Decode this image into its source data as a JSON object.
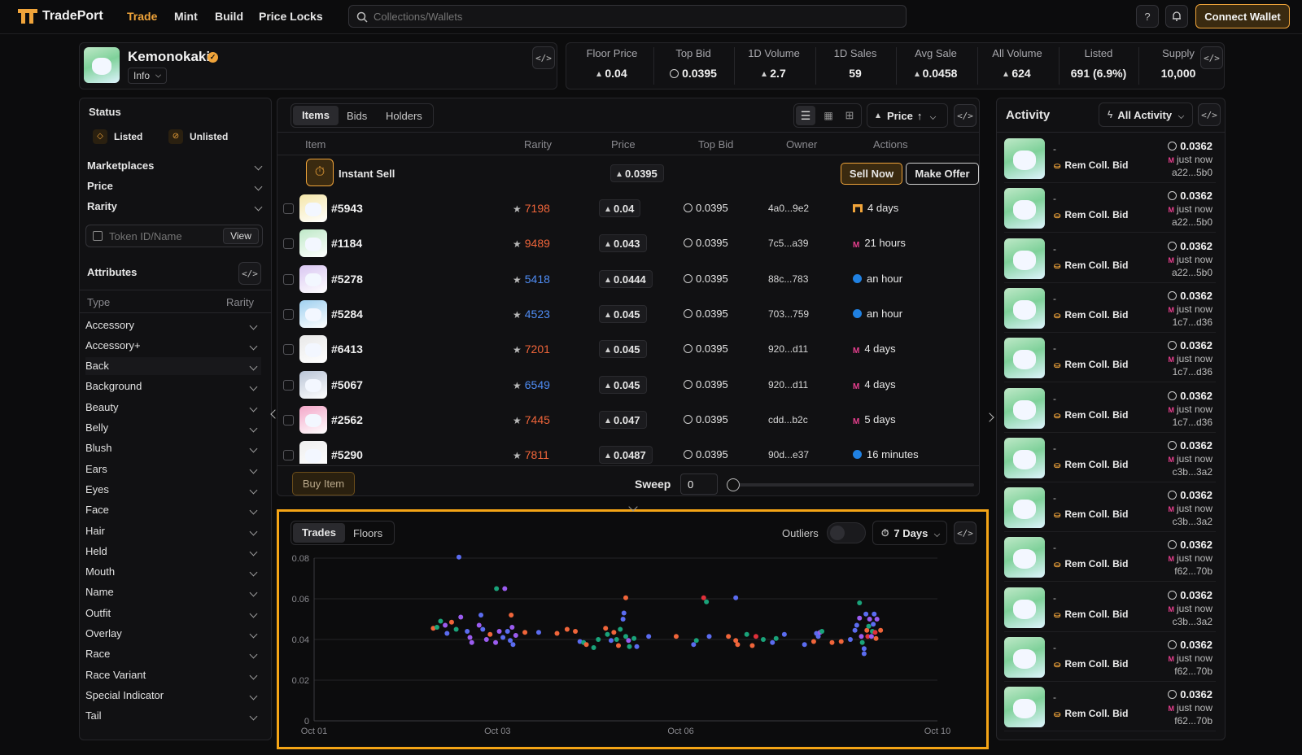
{
  "nav": {
    "brand": "TradePort",
    "links": [
      "Trade",
      "Mint",
      "Build",
      "Price Locks"
    ],
    "search_placeholder": "Collections/Wallets",
    "help_label": "?",
    "connect_label": "Connect Wallet"
  },
  "collection": {
    "name": "Kemonokaki",
    "info_label": "Info",
    "embed_label": "</>"
  },
  "stats": [
    {
      "label": "Floor Price",
      "value": "0.04",
      "icon": "eth"
    },
    {
      "label": "Top Bid",
      "value": "0.0395",
      "icon": "coin"
    },
    {
      "label": "1D Volume",
      "value": "2.7",
      "icon": "eth"
    },
    {
      "label": "1D Sales",
      "value": "59",
      "icon": ""
    },
    {
      "label": "Avg Sale",
      "value": "0.0458",
      "icon": "eth"
    },
    {
      "label": "All Volume",
      "value": "624",
      "icon": "eth"
    },
    {
      "label": "Listed",
      "value": "691 (6.9%)",
      "icon": ""
    },
    {
      "label": "Supply",
      "value": "10,000",
      "icon": ""
    }
  ],
  "filters": {
    "status_title": "Status",
    "listed_label": "Listed",
    "unlisted_label": "Unlisted",
    "sections": [
      "Marketplaces",
      "Price",
      "Rarity"
    ],
    "token_placeholder": "Token ID/Name",
    "view_label": "View",
    "attributes_title": "Attributes",
    "type_header": "Type",
    "rarity_header": "Rarity",
    "attributes": [
      "Accessory",
      "Accessory+",
      "Back",
      "Background",
      "Beauty",
      "Belly",
      "Blush",
      "Ears",
      "Eyes",
      "Face",
      "Hair",
      "Held",
      "Mouth",
      "Name",
      "Outfit",
      "Overlay",
      "Race",
      "Race Variant",
      "Special Indicator",
      "Tail"
    ]
  },
  "items": {
    "tabs": [
      "Items",
      "Bids",
      "Holders"
    ],
    "sort_label": "Price",
    "columns": [
      "Item",
      "Rarity",
      "Price",
      "Top Bid",
      "Owner",
      "Actions"
    ],
    "instant_sell": {
      "label": "Instant Sell",
      "price": "0.0395",
      "sell_now": "Sell Now",
      "make_offer": "Make Offer"
    },
    "rows": [
      {
        "name": "#5943",
        "rarity": "7198",
        "rarity_color": "#f0653a",
        "price": "0.04",
        "bid": "0.0395",
        "owner": "4a0...9e2",
        "market": "tradeport",
        "time": "4 days",
        "thumb": "#f5e6a8"
      },
      {
        "name": "#1184",
        "rarity": "9489",
        "rarity_color": "#f0653a",
        "price": "0.043",
        "bid": "0.0395",
        "owner": "7c5...a39",
        "market": "magiceden",
        "time": "21 hours",
        "thumb": "#bfe9c8"
      },
      {
        "name": "#5278",
        "rarity": "5418",
        "rarity_color": "#4f8df5",
        "price": "0.0444",
        "bid": "0.0395",
        "owner": "88c...783",
        "market": "opensea",
        "time": "an hour",
        "thumb": "#d9c6f2"
      },
      {
        "name": "#5284",
        "rarity": "4523",
        "rarity_color": "#4f8df5",
        "price": "0.045",
        "bid": "0.0395",
        "owner": "703...759",
        "market": "opensea",
        "time": "an hour",
        "thumb": "#9fd0f0"
      },
      {
        "name": "#6413",
        "rarity": "7201",
        "rarity_color": "#f0653a",
        "price": "0.045",
        "bid": "0.0395",
        "owner": "920...d11",
        "market": "magiceden",
        "time": "4 days",
        "thumb": "#e8e8e8"
      },
      {
        "name": "#5067",
        "rarity": "6549",
        "rarity_color": "#4f8df5",
        "price": "0.045",
        "bid": "0.0395",
        "owner": "920...d11",
        "market": "magiceden",
        "time": "4 days",
        "thumb": "#b9c4d6"
      },
      {
        "name": "#2562",
        "rarity": "7445",
        "rarity_color": "#f0653a",
        "price": "0.047",
        "bid": "0.0395",
        "owner": "cdd...b2c",
        "market": "magiceden",
        "time": "5 days",
        "thumb": "#f3a6c8"
      },
      {
        "name": "#5290",
        "rarity": "7811",
        "rarity_color": "#f0653a",
        "price": "0.0487",
        "bid": "0.0395",
        "owner": "90d...e37",
        "market": "opensea",
        "time": "16 minutes",
        "thumb": "#eeeeee"
      }
    ],
    "buy_label": "Buy Item",
    "sweep_label": "Sweep",
    "sweep_value": "0"
  },
  "chart_panel": {
    "tabs": [
      "Trades",
      "Floors"
    ],
    "outliers_label": "Outliers",
    "range_label": "7 Days"
  },
  "chart_data": {
    "type": "scatter",
    "xlabel": "",
    "ylabel": "",
    "x_ticks": [
      "Oct 01",
      "Oct 03",
      "Oct 06",
      "Oct 10"
    ],
    "x_tick_days": [
      0,
      2,
      4,
      6.8
    ],
    "y_ticks": [
      "0",
      "0.02",
      "0.04",
      "0.06",
      "0.08"
    ],
    "ylim": [
      0,
      0.08
    ],
    "xlim_days": [
      0,
      6.8
    ],
    "grid": true,
    "colors": {
      "blue": "#5b6cf0",
      "purple": "#9b5cf0",
      "orange": "#f0653a",
      "green": "#1aa37a",
      "red": "#e0303a"
    },
    "points": [
      {
        "x": 1.58,
        "y": 0.0805,
        "c": "blue"
      },
      {
        "x": 1.99,
        "y": 0.065,
        "c": "green"
      },
      {
        "x": 2.08,
        "y": 0.065,
        "c": "purple"
      },
      {
        "x": 2.15,
        "y": 0.052,
        "c": "orange"
      },
      {
        "x": 2.16,
        "y": 0.046,
        "c": "purple"
      },
      {
        "x": 3.4,
        "y": 0.0605,
        "c": "orange"
      },
      {
        "x": 4.25,
        "y": 0.0605,
        "c": "red"
      },
      {
        "x": 4.28,
        "y": 0.0585,
        "c": "green"
      },
      {
        "x": 4.6,
        "y": 0.0605,
        "c": "blue"
      },
      {
        "x": 5.95,
        "y": 0.058,
        "c": "green"
      },
      {
        "x": 1.3,
        "y": 0.0455,
        "c": "orange"
      },
      {
        "x": 1.34,
        "y": 0.046,
        "c": "green"
      },
      {
        "x": 1.38,
        "y": 0.049,
        "c": "green"
      },
      {
        "x": 1.43,
        "y": 0.047,
        "c": "purple"
      },
      {
        "x": 1.45,
        "y": 0.043,
        "c": "blue"
      },
      {
        "x": 1.5,
        "y": 0.0485,
        "c": "orange"
      },
      {
        "x": 1.55,
        "y": 0.045,
        "c": "green"
      },
      {
        "x": 1.6,
        "y": 0.051,
        "c": "purple"
      },
      {
        "x": 1.67,
        "y": 0.044,
        "c": "blue"
      },
      {
        "x": 1.7,
        "y": 0.041,
        "c": "purple"
      },
      {
        "x": 1.72,
        "y": 0.0385,
        "c": "purple"
      },
      {
        "x": 1.8,
        "y": 0.047,
        "c": "purple"
      },
      {
        "x": 1.82,
        "y": 0.052,
        "c": "blue"
      },
      {
        "x": 1.84,
        "y": 0.045,
        "c": "blue"
      },
      {
        "x": 1.88,
        "y": 0.04,
        "c": "purple"
      },
      {
        "x": 1.92,
        "y": 0.0425,
        "c": "orange"
      },
      {
        "x": 1.98,
        "y": 0.0385,
        "c": "purple"
      },
      {
        "x": 2.02,
        "y": 0.044,
        "c": "purple"
      },
      {
        "x": 2.06,
        "y": 0.041,
        "c": "blue"
      },
      {
        "x": 2.11,
        "y": 0.044,
        "c": "blue"
      },
      {
        "x": 2.14,
        "y": 0.0395,
        "c": "blue"
      },
      {
        "x": 2.17,
        "y": 0.0375,
        "c": "blue"
      },
      {
        "x": 2.2,
        "y": 0.042,
        "c": "purple"
      },
      {
        "x": 2.3,
        "y": 0.0435,
        "c": "orange"
      },
      {
        "x": 2.45,
        "y": 0.0435,
        "c": "blue"
      },
      {
        "x": 2.65,
        "y": 0.043,
        "c": "orange"
      },
      {
        "x": 2.76,
        "y": 0.045,
        "c": "orange"
      },
      {
        "x": 2.85,
        "y": 0.044,
        "c": "orange"
      },
      {
        "x": 2.9,
        "y": 0.039,
        "c": "blue"
      },
      {
        "x": 2.94,
        "y": 0.0385,
        "c": "green"
      },
      {
        "x": 2.97,
        "y": 0.0375,
        "c": "orange"
      },
      {
        "x": 3.05,
        "y": 0.036,
        "c": "green"
      },
      {
        "x": 3.1,
        "y": 0.04,
        "c": "green"
      },
      {
        "x": 3.18,
        "y": 0.0455,
        "c": "orange"
      },
      {
        "x": 3.2,
        "y": 0.0425,
        "c": "green"
      },
      {
        "x": 3.24,
        "y": 0.0395,
        "c": "blue"
      },
      {
        "x": 3.27,
        "y": 0.0435,
        "c": "orange"
      },
      {
        "x": 3.3,
        "y": 0.04,
        "c": "green"
      },
      {
        "x": 3.32,
        "y": 0.037,
        "c": "orange"
      },
      {
        "x": 3.34,
        "y": 0.045,
        "c": "green"
      },
      {
        "x": 3.37,
        "y": 0.05,
        "c": "blue"
      },
      {
        "x": 3.38,
        "y": 0.053,
        "c": "blue"
      },
      {
        "x": 3.4,
        "y": 0.0415,
        "c": "green"
      },
      {
        "x": 3.43,
        "y": 0.0395,
        "c": "purple"
      },
      {
        "x": 3.44,
        "y": 0.0365,
        "c": "green"
      },
      {
        "x": 3.49,
        "y": 0.0405,
        "c": "green"
      },
      {
        "x": 3.52,
        "y": 0.0365,
        "c": "blue"
      },
      {
        "x": 3.65,
        "y": 0.0415,
        "c": "blue"
      },
      {
        "x": 3.95,
        "y": 0.0415,
        "c": "orange"
      },
      {
        "x": 4.14,
        "y": 0.0375,
        "c": "blue"
      },
      {
        "x": 4.17,
        "y": 0.0395,
        "c": "green"
      },
      {
        "x": 4.31,
        "y": 0.0415,
        "c": "blue"
      },
      {
        "x": 4.52,
        "y": 0.0415,
        "c": "orange"
      },
      {
        "x": 4.6,
        "y": 0.0395,
        "c": "orange"
      },
      {
        "x": 4.62,
        "y": 0.0375,
        "c": "orange"
      },
      {
        "x": 4.72,
        "y": 0.0425,
        "c": "green"
      },
      {
        "x": 4.78,
        "y": 0.037,
        "c": "orange"
      },
      {
        "x": 4.82,
        "y": 0.0415,
        "c": "red"
      },
      {
        "x": 4.9,
        "y": 0.04,
        "c": "green"
      },
      {
        "x": 5.0,
        "y": 0.0385,
        "c": "blue"
      },
      {
        "x": 5.04,
        "y": 0.0405,
        "c": "green"
      },
      {
        "x": 5.13,
        "y": 0.0425,
        "c": "blue"
      },
      {
        "x": 5.35,
        "y": 0.0375,
        "c": "blue"
      },
      {
        "x": 5.45,
        "y": 0.039,
        "c": "orange"
      },
      {
        "x": 5.48,
        "y": 0.043,
        "c": "blue"
      },
      {
        "x": 5.5,
        "y": 0.0415,
        "c": "blue"
      },
      {
        "x": 5.52,
        "y": 0.0435,
        "c": "purple"
      },
      {
        "x": 5.54,
        "y": 0.044,
        "c": "green"
      },
      {
        "x": 5.65,
        "y": 0.0385,
        "c": "orange"
      },
      {
        "x": 5.75,
        "y": 0.039,
        "c": "orange"
      },
      {
        "x": 5.85,
        "y": 0.04,
        "c": "blue"
      },
      {
        "x": 5.9,
        "y": 0.0445,
        "c": "blue"
      },
      {
        "x": 5.92,
        "y": 0.047,
        "c": "blue"
      },
      {
        "x": 5.95,
        "y": 0.0505,
        "c": "purple"
      },
      {
        "x": 5.97,
        "y": 0.0415,
        "c": "purple"
      },
      {
        "x": 5.98,
        "y": 0.0385,
        "c": "green"
      },
      {
        "x": 6.0,
        "y": 0.0355,
        "c": "blue"
      },
      {
        "x": 6.0,
        "y": 0.033,
        "c": "blue"
      },
      {
        "x": 6.02,
        "y": 0.0525,
        "c": "blue"
      },
      {
        "x": 6.03,
        "y": 0.0445,
        "c": "orange"
      },
      {
        "x": 6.04,
        "y": 0.0415,
        "c": "red"
      },
      {
        "x": 6.05,
        "y": 0.0465,
        "c": "green"
      },
      {
        "x": 6.06,
        "y": 0.05,
        "c": "purple"
      },
      {
        "x": 6.08,
        "y": 0.0415,
        "c": "purple"
      },
      {
        "x": 6.09,
        "y": 0.044,
        "c": "green"
      },
      {
        "x": 6.1,
        "y": 0.0475,
        "c": "blue"
      },
      {
        "x": 6.11,
        "y": 0.0525,
        "c": "blue"
      },
      {
        "x": 6.12,
        "y": 0.0435,
        "c": "red"
      },
      {
        "x": 6.13,
        "y": 0.0405,
        "c": "orange"
      },
      {
        "x": 6.14,
        "y": 0.05,
        "c": "purple"
      },
      {
        "x": 6.18,
        "y": 0.0445,
        "c": "orange"
      }
    ]
  },
  "activity": {
    "title": "Activity",
    "filter_label": "All Activity",
    "rows": [
      {
        "amount": "0.0362",
        "when": "just now",
        "addr": "a22...5b0",
        "kind": "Rem Coll. Bid",
        "dash": "-"
      },
      {
        "amount": "0.0362",
        "when": "just now",
        "addr": "a22...5b0",
        "kind": "Rem Coll. Bid",
        "dash": "-"
      },
      {
        "amount": "0.0362",
        "when": "just now",
        "addr": "a22...5b0",
        "kind": "Rem Coll. Bid",
        "dash": "-"
      },
      {
        "amount": "0.0362",
        "when": "just now",
        "addr": "1c7...d36",
        "kind": "Rem Coll. Bid",
        "dash": "-"
      },
      {
        "amount": "0.0362",
        "when": "just now",
        "addr": "1c7...d36",
        "kind": "Rem Coll. Bid",
        "dash": "-"
      },
      {
        "amount": "0.0362",
        "when": "just now",
        "addr": "1c7...d36",
        "kind": "Rem Coll. Bid",
        "dash": "-"
      },
      {
        "amount": "0.0362",
        "when": "just now",
        "addr": "c3b...3a2",
        "kind": "Rem Coll. Bid",
        "dash": "-"
      },
      {
        "amount": "0.0362",
        "when": "just now",
        "addr": "c3b...3a2",
        "kind": "Rem Coll. Bid",
        "dash": "-"
      },
      {
        "amount": "0.0362",
        "when": "just now",
        "addr": "f62...70b",
        "kind": "Rem Coll. Bid",
        "dash": "-"
      },
      {
        "amount": "0.0362",
        "when": "just now",
        "addr": "c3b...3a2",
        "kind": "Rem Coll. Bid",
        "dash": "-"
      },
      {
        "amount": "0.0362",
        "when": "just now",
        "addr": "f62...70b",
        "kind": "Rem Coll. Bid",
        "dash": "-"
      },
      {
        "amount": "0.0362",
        "when": "just now",
        "addr": "f62...70b",
        "kind": "Rem Coll. Bid",
        "dash": "-"
      }
    ]
  },
  "colors": {
    "accent": "#f0a43a",
    "highlight_border": "#f5a516"
  }
}
